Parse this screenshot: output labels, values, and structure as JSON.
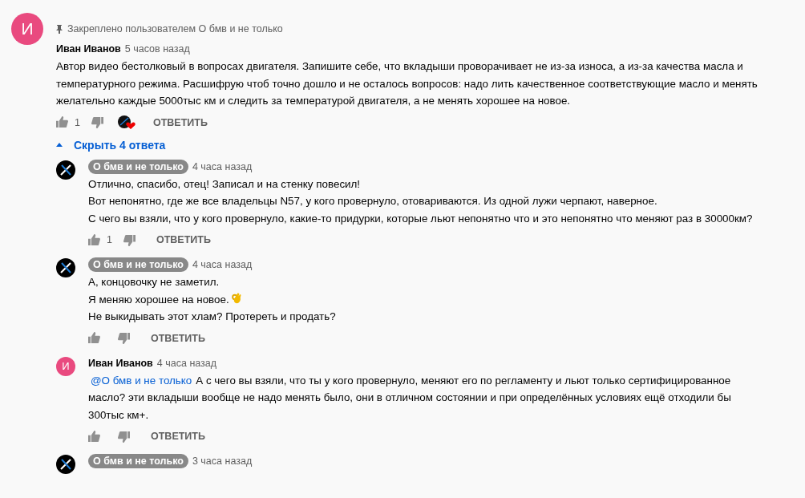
{
  "comment": {
    "pinned_by": "Закреплено пользователем О бмв и не только",
    "avatar_letter": "И",
    "author": "Иван Иванов",
    "owner": false,
    "time": "5 часов назад",
    "text": "Автор видео бестолковый в вопросах двигателя. Запишите себе, что вкладыши проворачивает не из-за износа, а  из-за качества масла и температурного режима. Расшифрую чтоб точно дошло и не осталось вопросов: надо лить качественное соответствующие масло и менять желательно каждые 5000тыс км и следить за температурой двигателя, а не менять хорошее на новое.",
    "likes": "1",
    "creator_heart": true,
    "reply_label": "ОТВЕТИТЬ"
  },
  "replies_toggle": {
    "label": "Скрыть 4 ответа",
    "expanded": true
  },
  "replies": [
    {
      "author": "О бмв и не только",
      "owner": true,
      "time": "4 часа назад",
      "lines": [
        {
          "text": "Отлично, спасибо, отец! Записал и на стенку повесил!"
        },
        {
          "text": "Вот непонятно, где же все владельцы N57, у кого провернуло, отовариваются. Из одной лужи черпают, наверное."
        },
        {
          "text": "С чего вы взяли, что у кого провернуло, какие-то придурки, которые льют непонятно что и это непонятно что меняют раз в 30000км?"
        }
      ],
      "likes": "1",
      "reply_label": "ОТВЕТИТЬ"
    },
    {
      "author": "О бмв и не только",
      "owner": true,
      "time": "4 часа назад",
      "lines": [
        {
          "text": "А, концовочку не заметил."
        },
        {
          "text": "Я меняю хорошее на новое.",
          "ok_hand": true
        },
        {
          "text": "Не выкидывать этот хлам? Протереть и продать?"
        }
      ],
      "reply_label": "ОТВЕТИТЬ"
    },
    {
      "avatar_letter": "И",
      "author": "Иван Иванов",
      "owner": false,
      "time": "4 часа назад",
      "mention": "@О бмв и не только",
      "lines": [
        {
          "text": "А с чего вы взяли, что ты у кого провернуло, меняют его по регламенту и льют только сертифицированное масло? эти вкладыши вообще не надо менять было, они в отличном состоянии и при определённых условиях ещё отходили бы 300тыс км+."
        }
      ],
      "reply_label": "ОТВЕТИТЬ"
    },
    {
      "author": "О бмв и не только",
      "owner": true,
      "time": "3 часа назад"
    }
  ]
}
